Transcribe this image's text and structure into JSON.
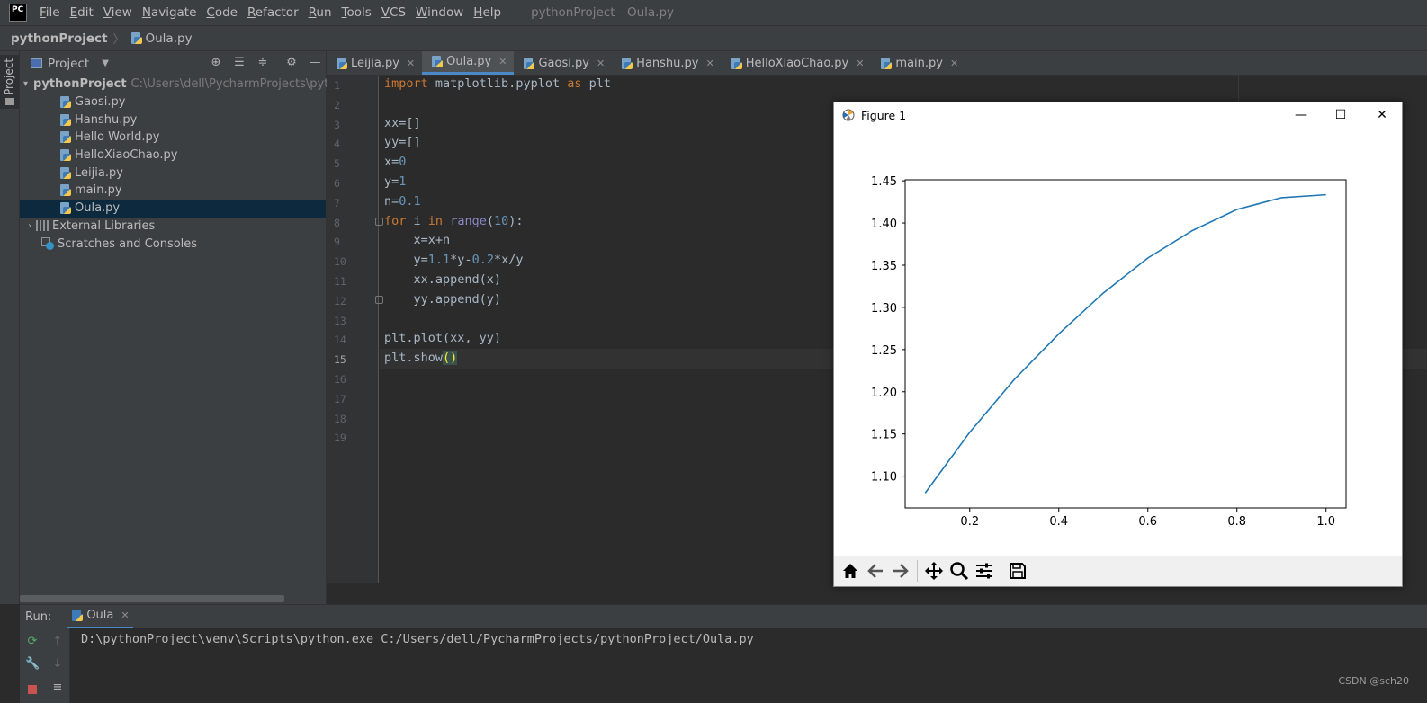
{
  "app": {
    "logo_text": "PC",
    "window_title": "pythonProject - Oula.py"
  },
  "menu": [
    {
      "first": "F",
      "rest": "ile"
    },
    {
      "first": "E",
      "rest": "dit"
    },
    {
      "first": "V",
      "rest": "iew"
    },
    {
      "first": "N",
      "rest": "avigate"
    },
    {
      "first": "C",
      "rest": "ode"
    },
    {
      "first": "R",
      "rest": "efactor"
    },
    {
      "first": "R",
      "rest": "un"
    },
    {
      "first": "T",
      "rest": "ools"
    },
    {
      "first": "V",
      "rest": "CS"
    },
    {
      "first": "W",
      "rest": "indow"
    },
    {
      "first": "H",
      "rest": "elp"
    }
  ],
  "breadcrumb": {
    "project": "pythonProject",
    "file": "Oula.py"
  },
  "left_strip": {
    "tab_label": "Project"
  },
  "project_panel": {
    "title": "Project",
    "root": {
      "name": "pythonProject",
      "path": "C:\\Users\\dell\\PycharmProjects\\pytho"
    },
    "files": [
      "Gaosi.py",
      "Hanshu.py",
      "Hello World.py",
      "HelloXiaoChao.py",
      "Leijia.py",
      "main.py",
      "Oula.py"
    ],
    "selected_file": "Oula.py",
    "external_libraries": "External Libraries",
    "scratches": "Scratches and Consoles"
  },
  "editor_tabs": [
    {
      "label": "Leijia.py",
      "active": false
    },
    {
      "label": "Oula.py",
      "active": true
    },
    {
      "label": "Gaosi.py",
      "active": false
    },
    {
      "label": "Hanshu.py",
      "active": false
    },
    {
      "label": "HelloXiaoChao.py",
      "active": false
    },
    {
      "label": "main.py",
      "active": false
    }
  ],
  "editor": {
    "line_numbers": [
      "1",
      "2",
      "3",
      "4",
      "5",
      "6",
      "7",
      "8",
      "9",
      "10",
      "11",
      "12",
      "13",
      "14",
      "15",
      "16",
      "17",
      "18",
      "19"
    ],
    "current_line": "15",
    "code_lines": [
      "import matplotlib.pyplot as plt",
      "",
      "xx=[]",
      "yy=[]",
      "x=0",
      "y=1",
      "n=0.1",
      "for i in range(10):",
      "    x=x+n",
      "    y=1.1*y-0.2*x/y",
      "    xx.append(x)",
      "    yy.append(y)",
      "",
      "plt.plot(xx, yy)",
      "plt.show()",
      "",
      "",
      "",
      ""
    ]
  },
  "figure": {
    "title": "Figure 1",
    "toolbar": [
      "home-icon",
      "back-arrow-icon",
      "forward-arrow-icon",
      "pan-icon",
      "zoom-icon",
      "configure-subplots-icon",
      "save-icon"
    ]
  },
  "chart_data": {
    "type": "line",
    "title": "",
    "xlabel": "",
    "ylabel": "",
    "x": [
      0.1,
      0.2,
      0.3,
      0.4,
      0.5,
      0.6,
      0.7,
      0.8,
      0.9,
      1.0
    ],
    "series": [
      {
        "values": [
          1.08,
          1.152,
          1.2145,
          1.2685,
          1.317,
          1.3585,
          1.391,
          1.416,
          1.43,
          1.4335
        ]
      }
    ],
    "xlim": [
      0.055,
      1.045
    ],
    "ylim": [
      1.0623,
      1.4512
    ],
    "xticks": [
      0.2,
      0.4,
      0.6,
      0.8,
      1.0
    ],
    "xtick_labels": [
      "0.2",
      "0.4",
      "0.6",
      "0.8",
      "1.0"
    ],
    "yticks": [
      1.1,
      1.15,
      1.2,
      1.25,
      1.3,
      1.35,
      1.4,
      1.45
    ],
    "ytick_labels": [
      "1.10",
      "1.15",
      "1.20",
      "1.25",
      "1.30",
      "1.35",
      "1.40",
      "1.45"
    ],
    "grid": false,
    "line_color": "#1f77b4"
  },
  "run_panel": {
    "label": "Run:",
    "tab": "Oula",
    "console_line": "D:\\pythonProject\\venv\\Scripts\\python.exe C:/Users/dell/PycharmProjects/pythonProject/Oula.py"
  },
  "watermark": "CSDN @sch20",
  "colors": {
    "accent": "#4a88c7",
    "selection": "#0d293e",
    "keyword": "#cc7832",
    "number": "#6897bb"
  }
}
